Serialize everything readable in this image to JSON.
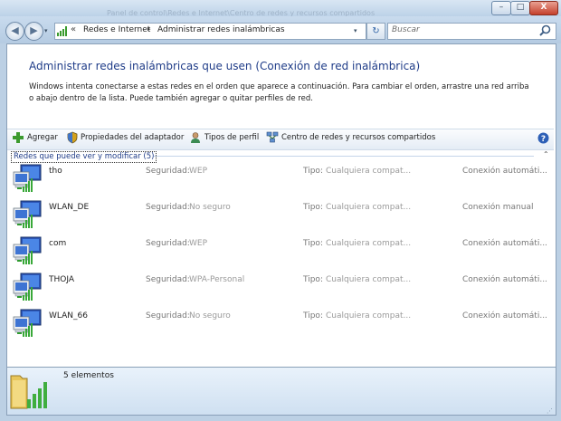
{
  "window": {
    "faded_title": "Panel de control\\Redes e Internet\\Centro de redes y recursos compartidos",
    "minimize": "–",
    "maximize": "□",
    "close": "X"
  },
  "address": {
    "overflow": "«",
    "crumbs": [
      "Redes e Internet",
      "Administrar redes inalámbricas"
    ],
    "separator": "▸",
    "dropdown": "▾",
    "refresh": "↻"
  },
  "search": {
    "placeholder": "Buscar"
  },
  "header": {
    "title": "Administrar redes inalámbricas que usen (Conexión de red inalámbrica)",
    "description": "Windows intenta conectarse a estas redes en el orden que aparece a continuación. Para cambiar el orden, arrastre una red arriba o abajo dentro de la lista. Puede también agregar o quitar perfiles de red."
  },
  "toolbar": {
    "add": "Agregar",
    "adapter_properties": "Propiedades del adaptador",
    "profile_types": "Tipos de perfil",
    "network_center": "Centro de redes y recursos compartidos"
  },
  "group": {
    "label": "Redes que puede ver y modificar (5)",
    "collapse": "⌃"
  },
  "labels": {
    "security": "Seguridad:",
    "type": "Tipo:"
  },
  "networks": [
    {
      "name": "tho",
      "security": "WEP",
      "type": "Cualquiera compat...",
      "mode": "Conexión automáti..."
    },
    {
      "name": "WLAN_DE",
      "security": "No seguro",
      "type": "Cualquiera compat...",
      "mode": "Conexión manual"
    },
    {
      "name": "com",
      "security": "WEP",
      "type": "Cualquiera compat...",
      "mode": "Conexión automáti..."
    },
    {
      "name": "THOJA",
      "security": "WPA-Personal",
      "type": "Cualquiera compat...",
      "mode": "Conexión automáti..."
    },
    {
      "name": "WLAN_66",
      "security": "No seguro",
      "type": "Cualquiera compat...",
      "mode": "Conexión automáti..."
    }
  ],
  "details": {
    "count": "5 elementos",
    "grip": "⋰"
  },
  "colors": {
    "accent": "#1f3c88",
    "content_bg": "#ffffff",
    "frame": "#bcd0e4"
  }
}
